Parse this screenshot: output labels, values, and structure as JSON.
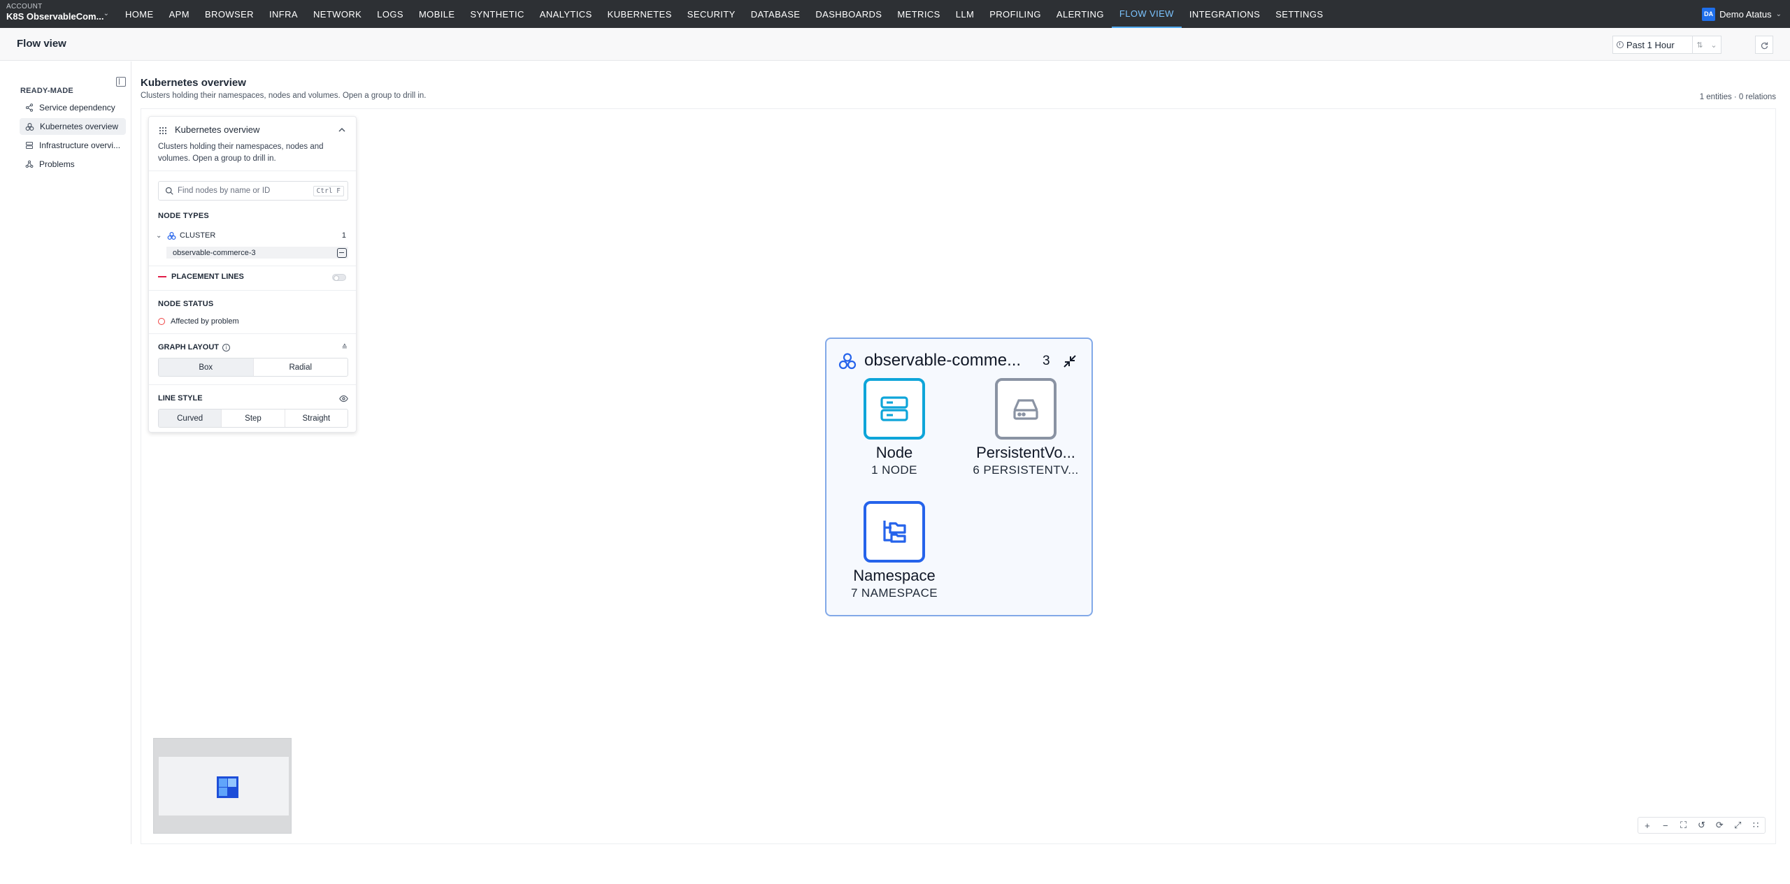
{
  "topnav": {
    "account_label": "ACCOUNT",
    "account_value": "K8S ObservableCom...",
    "items": [
      "HOME",
      "APM",
      "BROWSER",
      "INFRA",
      "NETWORK",
      "LOGS",
      "MOBILE",
      "SYNTHETIC",
      "ANALYTICS",
      "KUBERNETES",
      "SECURITY",
      "DATABASE",
      "DASHBOARDS",
      "METRICS",
      "LLM",
      "PROFILING",
      "ALERTING",
      "FLOW VIEW",
      "INTEGRATIONS",
      "SETTINGS"
    ],
    "active_item": "FLOW VIEW",
    "user_initials": "DA",
    "user_name": "Demo Atatus"
  },
  "header": {
    "title": "Flow view",
    "time_range": "Past 1 Hour"
  },
  "sidebar": {
    "section": "READY-MADE",
    "items": [
      {
        "label": "Service dependency",
        "icon": "share-nodes-icon"
      },
      {
        "label": "Kubernetes overview",
        "icon": "cluster-icon",
        "active": true
      },
      {
        "label": "Infrastructure overvi...",
        "icon": "server-icon"
      },
      {
        "label": "Problems",
        "icon": "problems-icon"
      }
    ]
  },
  "main": {
    "title": "Kubernetes overview",
    "subtitle": "Clusters holding their namespaces, nodes and volumes. Open a group to drill in.",
    "stats": "1 entities · 0 relations"
  },
  "panel": {
    "title": "Kubernetes overview",
    "description": "Clusters holding their namespaces, nodes and volumes. Open a group to drill in.",
    "search_placeholder": "Find nodes by name or ID",
    "search_shortcut": "Ctrl F",
    "node_types_label": "NODE TYPES",
    "cluster_label": "CLUSTER",
    "cluster_count": "1",
    "cluster_item": "observable-commerce-3",
    "placement_lines_label": "PLACEMENT LINES",
    "placement_lines_on": false,
    "node_status_label": "NODE STATUS",
    "affected_label": "Affected by problem",
    "graph_layout_label": "GRAPH LAYOUT",
    "layout_options": [
      "Box",
      "Radial"
    ],
    "layout_selected": "Box",
    "line_style_label": "LINE STYLE",
    "line_options": [
      "Curved",
      "Step",
      "Straight"
    ],
    "line_selected": "Curved"
  },
  "cluster": {
    "title": "observable-comme...",
    "count": "3",
    "nodes": [
      {
        "name": "Node",
        "count": "1 NODE",
        "icon": "server-icon",
        "color": "#0ea5d9"
      },
      {
        "name": "PersistentVo...",
        "count": "6 PERSISTENTV...",
        "icon": "hard-drive-icon",
        "color": "#8a93a3"
      },
      {
        "name": "Namespace",
        "count": "7 NAMESPACE",
        "icon": "namespace-icon",
        "color": "#2563eb"
      }
    ]
  },
  "colors": {
    "nav_bg": "#2d3034",
    "nav_active": "#7cc4ff",
    "accent": "#2563eb",
    "cluster_border": "#82a9e8"
  }
}
